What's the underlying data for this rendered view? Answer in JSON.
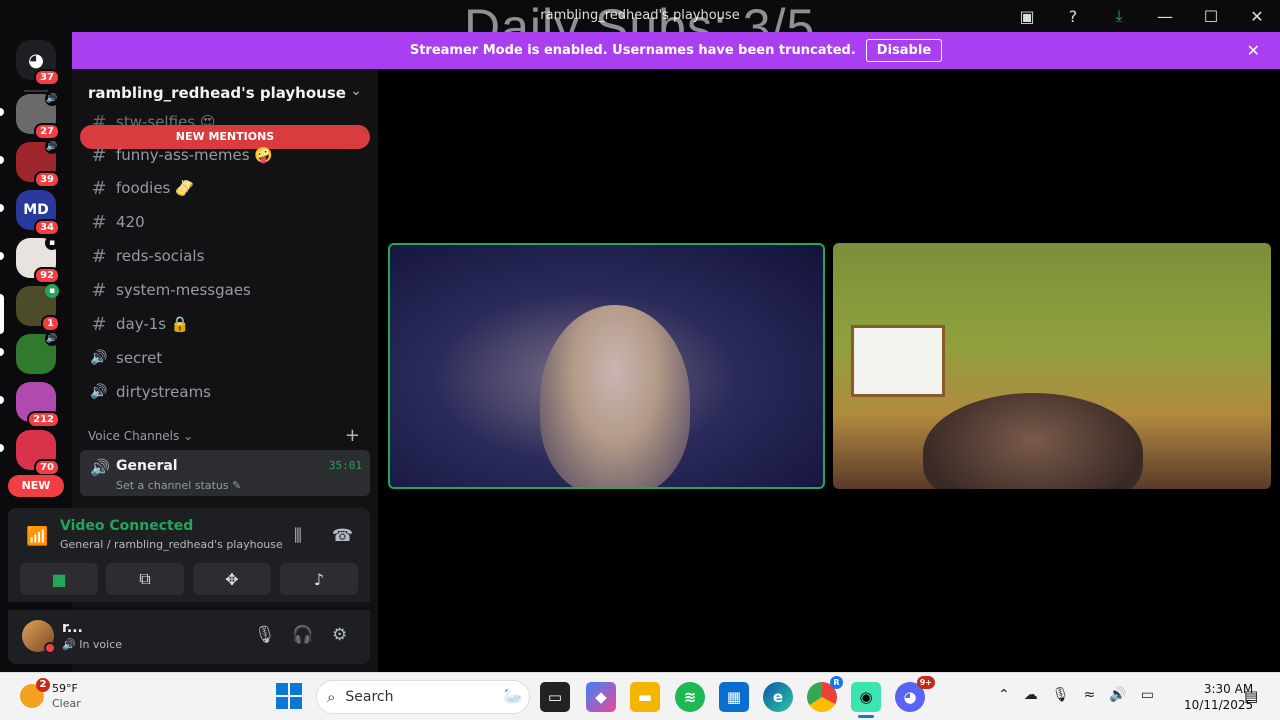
{
  "window": {
    "title": "rambling_redhead's playhouse",
    "overlay": "Daily Subs: 3/5"
  },
  "titlebar_icons": [
    "screen-share-icon",
    "help-icon",
    "download-icon",
    "minimize-icon",
    "maximize-icon",
    "close-icon"
  ],
  "streamer_banner": {
    "text": "Streamer Mode is enabled. Usernames have been truncated.",
    "button": "Disable"
  },
  "rail": {
    "home_badge": "37",
    "servers": [
      {
        "badge": "27",
        "color": "#6a6a6a"
      },
      {
        "badge": "39",
        "color": "#a0262e"
      },
      {
        "badge": "34",
        "color": "#2a3a9c",
        "label": "MD"
      },
      {
        "badge": "92",
        "color": "#e8e3dc"
      },
      {
        "badge": "1",
        "color": "#4c4c28"
      },
      {
        "badge": "",
        "color": "#2f7a2f"
      },
      {
        "badge": "212",
        "color": "#b04ab0"
      },
      {
        "badge": "70",
        "color": "#d8334a"
      }
    ],
    "new_label": "NEW"
  },
  "sidebar": {
    "server_name": "rambling_redhead's playhouse",
    "mentions_label": "NEW MENTIONS",
    "channels": [
      {
        "name": "stw-selfies 😍",
        "icon": "#"
      },
      {
        "name": "funny-ass-memes 🤪",
        "icon": "#"
      },
      {
        "name": "foodies 🫔",
        "icon": "#"
      },
      {
        "name": "420",
        "icon": "#"
      },
      {
        "name": "reds-socials",
        "icon": "#"
      },
      {
        "name": "system-messgaes",
        "icon": "#"
      },
      {
        "name": "day-1s 🔒",
        "icon": "#"
      },
      {
        "name": "secret",
        "icon": "🔊"
      },
      {
        "name": "dirtystreams",
        "icon": "🔊"
      }
    ],
    "voice_header": "Voice Channels",
    "active_voice": {
      "name": "General",
      "status": "Set a channel status ✎",
      "time": "35:01"
    }
  },
  "voice_panel": {
    "connected": "Video Connected",
    "location": "General / rambling_redhead's playhouse"
  },
  "user": {
    "name": "r...",
    "status": "In voice"
  },
  "taskbar": {
    "weather_badge": "2",
    "temp": "59°F",
    "condition": "Clear",
    "search_placeholder": "Search",
    "discord_badge": "9+",
    "chrome_badge": "R",
    "time": "3:30 AM",
    "date": "10/11/2025"
  }
}
